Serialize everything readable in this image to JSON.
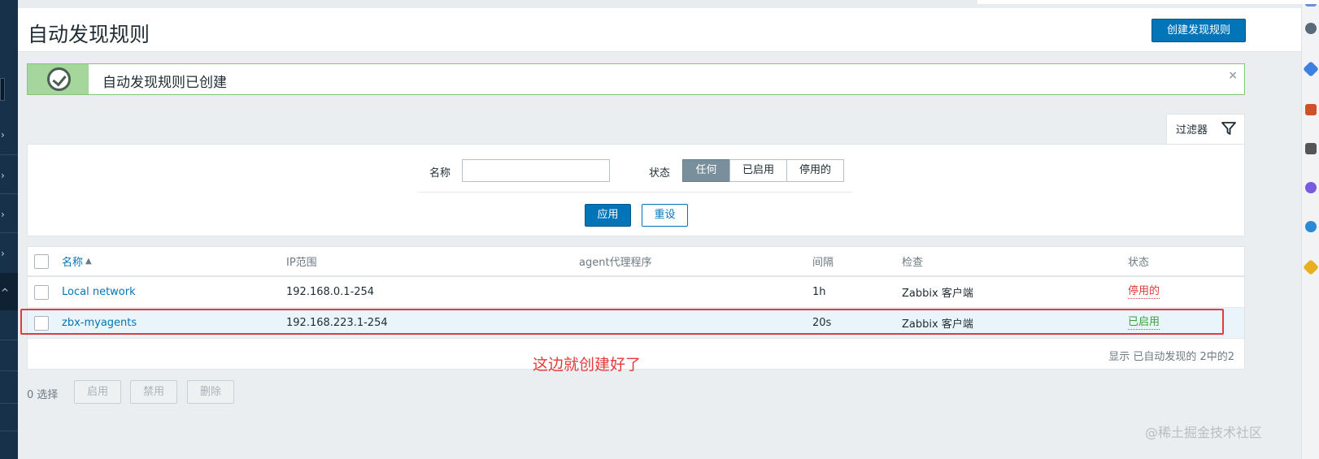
{
  "page": {
    "title": "自动发现规则",
    "create_button": "创建发现规则"
  },
  "message": {
    "text": "自动发现规则已创建",
    "close": "×"
  },
  "filter": {
    "tab_label": "过滤器",
    "name_label": "名称",
    "name_value": "",
    "status_label": "状态",
    "status_options": [
      "任何",
      "已启用",
      "停用的"
    ],
    "status_selected": "任何",
    "apply": "应用",
    "reset": "重设"
  },
  "table": {
    "columns": [
      "名称",
      "IP范围",
      "agent代理程序",
      "间隔",
      "检查",
      "状态"
    ],
    "sort_indicator": "▲",
    "rows": [
      {
        "name": "Local network",
        "ip_range": "192.168.0.1-254",
        "proxy": "",
        "interval": "1h",
        "checks": "Zabbix 客户端",
        "status": "停用的"
      },
      {
        "name": "zbx-myagents",
        "ip_range": "192.168.223.1-254",
        "proxy": "",
        "interval": "20s",
        "checks": "Zabbix 客户端",
        "status": "已启用"
      }
    ],
    "footer": "显示 已自动发现的 2中的2"
  },
  "annotation": {
    "text": "这边就创建好了",
    "color": "#e33b3b"
  },
  "actions": {
    "selected": "0 选择",
    "enable": "启用",
    "disable": "禁用",
    "delete": "删除"
  },
  "watermark": "@稀土掘金技术社区",
  "colors": {
    "primary": "#0275b8",
    "success_bg": "#a5d69c",
    "disabled_status": "#dc3c3c",
    "enabled_status": "#3c9f3c"
  }
}
